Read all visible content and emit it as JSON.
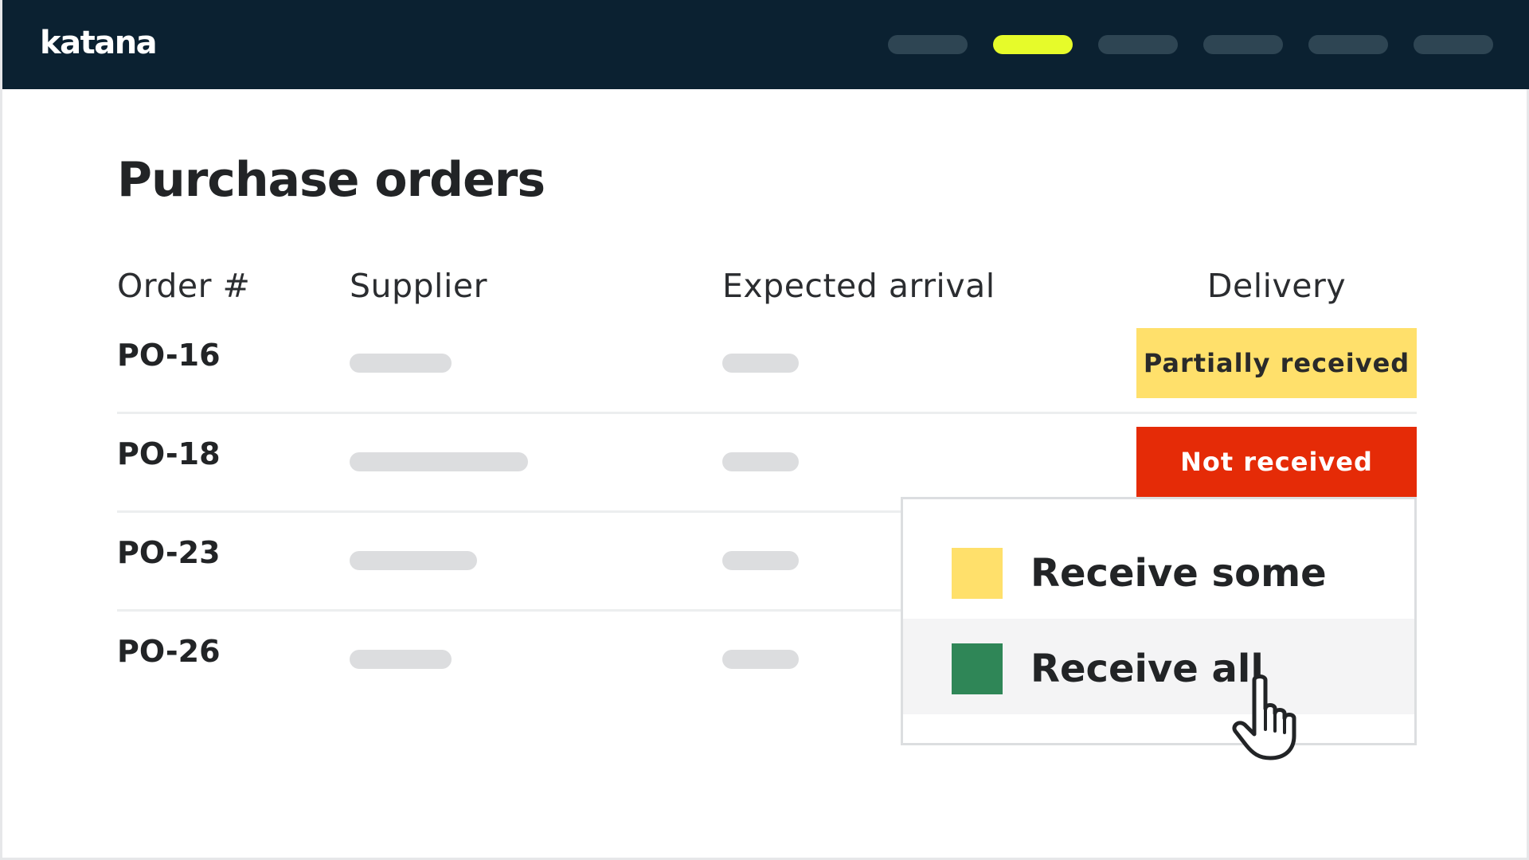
{
  "app": {
    "logo": "katana"
  },
  "nav": {
    "items": [
      "",
      "",
      "",
      "",
      "",
      ""
    ],
    "active_index": 1
  },
  "page": {
    "title": "Purchase orders"
  },
  "table": {
    "headers": {
      "order": "Order #",
      "supplier": "Supplier",
      "arrival": "Expected arrival",
      "delivery": "Delivery"
    },
    "rows": [
      {
        "order": "PO-16",
        "delivery": "Partially received"
      },
      {
        "order": "PO-18",
        "delivery": "Not received"
      },
      {
        "order": "PO-23"
      },
      {
        "order": "PO-26"
      }
    ]
  },
  "dropdown": {
    "items": [
      {
        "label": "Receive some",
        "color": "#ffe06b"
      },
      {
        "label": "Receive all",
        "color": "#2f8657"
      }
    ],
    "hovered": "Receive all"
  },
  "colors": {
    "topbar": "#0b2131",
    "nav_active": "#e6fb2a",
    "partial": "#ffe06b",
    "not_received": "#e52b07",
    "receive_all": "#2f8657"
  },
  "cursor": "hand-pointer-icon"
}
